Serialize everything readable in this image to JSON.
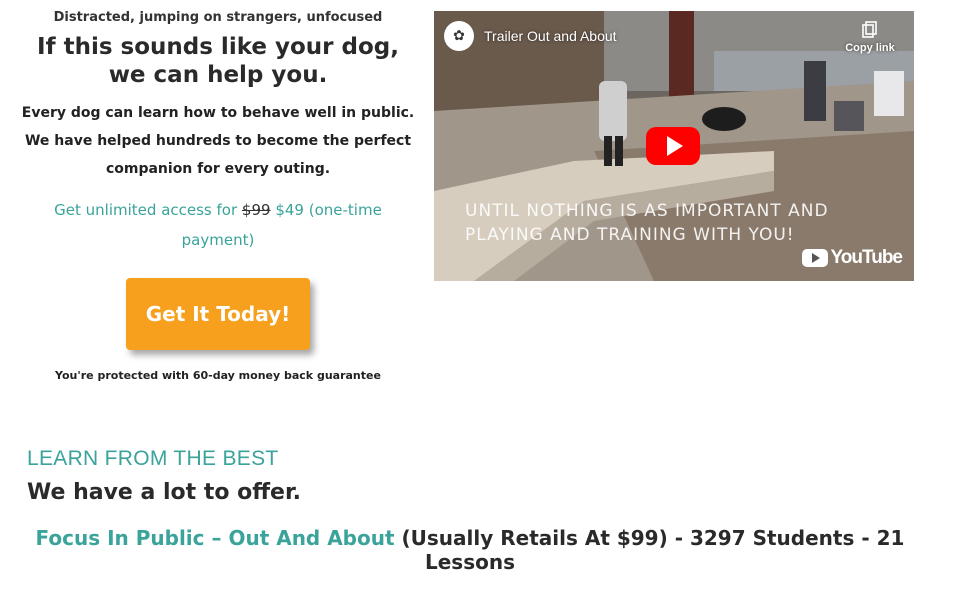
{
  "hero": {
    "tagline": "Distracted, jumping on strangers, unfocused",
    "headline": "If this sounds like your dog, we can help you.",
    "body_line1": "Every dog can learn how to behave well in public.",
    "body_line2": "We have helped hundreds to become the perfect",
    "body_line3": "companion for every outing.",
    "price_prefix": "Get unlimited access for",
    "price_old": "$99",
    "price_new": "$49 (one-time",
    "price_suffix": "payment)",
    "cta_label": "Get It Today!",
    "guarantee": "You're protected with 60-day money back guarantee"
  },
  "video": {
    "title": "Trailer Out and About",
    "copy_link_label": "Copy link",
    "overlay_line1": "UNTIL NOTHING IS AS IMPORTANT AND",
    "overlay_line2": "PLAYING AND TRAINING WITH YOU!",
    "brand": "YouTube",
    "icons": [
      "channel-logo-icon",
      "copy-link-icon",
      "play-icon",
      "youtube-logo-icon"
    ]
  },
  "section": {
    "kicker": "LEARN FROM THE BEST",
    "title": "We have a lot to offer."
  },
  "course": {
    "name": "Focus In Public – Out And About",
    "details": "(Usually Retails At $99) - 3297 Students - 21 Lessons"
  },
  "colors": {
    "accent_teal": "#3aa39a",
    "cta_orange": "#f7a01d",
    "youtube_red": "#ff0000"
  }
}
